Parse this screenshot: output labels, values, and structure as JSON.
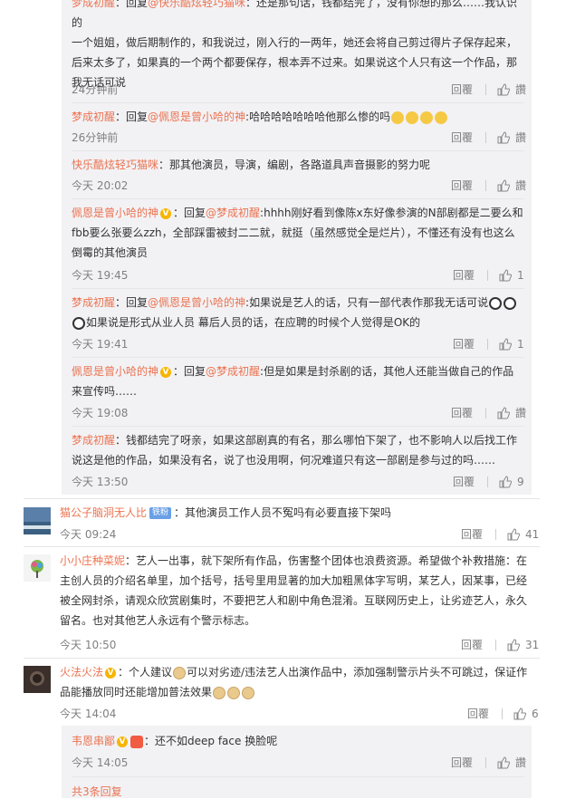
{
  "sub_replies": [
    {
      "author": "梦成初醒",
      "prefix": "：回复",
      "mention": "@快乐酷炫轻巧猫咪",
      "text_lines": [
        "：还是那句话，钱都结完了，没有你想的那么……我认识的",
        "一个姐姐，做后期制作的，和我说过，刚入行的一两年，她还会将自己剪过得片子保存起来，",
        "后来太多了，如果真的一个两个都要保存，根本弄不过来。如果说这个人只有这一个作品，那",
        "我无话可说"
      ],
      "time": "24分钟前",
      "reply_label": "回覆",
      "like_label": "讚"
    },
    {
      "author": "梦成初醒",
      "prefix": "：回复",
      "mention": "@佩恩是曾小哈的神",
      "text_lines": [
        ":哈哈哈哈哈哈哈他那么惨的吗"
      ],
      "emojis": [
        "grin",
        "grin",
        "grin",
        "grin"
      ],
      "time": "26分钟前",
      "reply_label": "回覆",
      "like_label": "讚"
    },
    {
      "author": "快乐酷炫轻巧猫咪",
      "prefix": "",
      "mention": "",
      "text_lines": [
        "：那其他演员，导演，编剧，各路道具声音摄影的努力呢"
      ],
      "time": "今天 20:02",
      "reply_label": "回覆",
      "like_label": "讚"
    },
    {
      "author": "佩恩是曾小哈的神",
      "prefix": "：回复",
      "mention": "@梦成初醒",
      "text_lines": [
        ":hhhh刚好看到像陈x东好像参演的N部剧都是二要么和",
        "fbb要么张要么zzh，全部踩雷被封二二就，就挺（虽然感觉全是烂片），不懂还有没有也这么",
        "倒霉的其他演员"
      ],
      "time": "今天 19:45",
      "reply_label": "回覆",
      "like_count": "1"
    },
    {
      "author": "梦成初醒",
      "prefix": "：回复",
      "mention": "@佩恩是曾小哈的神",
      "text_lines": [
        ":如果说是艺人的话，只有一部代表作那我无话可说",
        "如果说是形式从业人员 幕后人员的话，在应聘的时候个人觉得是OK的"
      ],
      "time": "今天 19:41",
      "reply_label": "回覆",
      "like_count": "1"
    },
    {
      "author": "佩恩是曾小哈的神",
      "prefix": "：回复",
      "mention": "@梦成初醒",
      "text_lines": [
        ":但是如果是封杀剧的话，其他人还能当做自己的作品",
        "来宣传吗……"
      ],
      "time": "今天 19:08",
      "reply_label": "回覆",
      "like_label": "讚"
    },
    {
      "author": "梦成初醒",
      "prefix": "",
      "mention": "",
      "text_lines": [
        "：钱都结完了呀亲，如果这部剧真的有名，那么哪怕下架了，也不影响人以后找工作",
        "说这是他的作品，如果没有名，说了也没用啊，何况难道只有这一部剧是参与过的吗……"
      ],
      "time": "今天 13:50",
      "reply_label": "回覆",
      "like_count": "9"
    }
  ],
  "comments": [
    {
      "author": "猫公子脑洞无人比",
      "badge": "铁粉",
      "text_lines": [
        "：其他演员工作人员不冤吗有必要直接下架吗"
      ],
      "time": "今天 09:24",
      "reply_label": "回覆",
      "like_count": "41"
    },
    {
      "author": "小小庄种菜妮",
      "text_lines": [
        "：艺人一出事，就下架所有作品，伤害整个团体也浪费资源。希望做个补救措施：在",
        "主创人员的介绍名单里，加个括号，括号里用显著的加大加粗黑体字写明，某艺人，因某事，已经",
        "被全网封杀，请观众欣赏剧集时，不要把艺人和剧中角色混淆。互联网历史上，让劣迹艺人，永久",
        "留名。也对其他艺人永远有个警示标志。"
      ],
      "time": "今天 10:50",
      "reply_label": "回覆",
      "like_count": "31"
    },
    {
      "author": "火法火法",
      "text_lines": [
        "：个人建议",
        "可以对劣迹/违法艺人出演作品中，添加强制警示片头不可跳过，保证作",
        "品能播放同时还能增加普法效果"
      ],
      "time": "今天 14:04",
      "reply_label": "回覆",
      "like_count": "6"
    }
  ],
  "nested": {
    "author": "韦恩串鄙",
    "text": "：还不如deep face 换脸呢",
    "time": "今天 14:05",
    "reply_label": "回覆",
    "like_label": "讚"
  },
  "more_replies": "共3条回复",
  "colors": {
    "name": "#eb7350",
    "time": "#808080",
    "reply_bg": "#f2f2f5"
  }
}
